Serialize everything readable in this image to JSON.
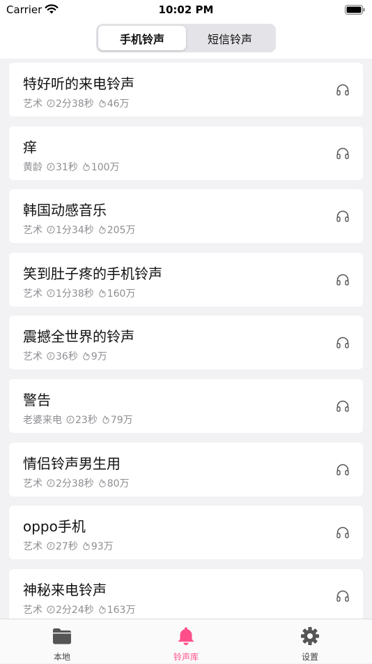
{
  "status_bar": {
    "carrier": "Carrier",
    "time": "10:02 PM"
  },
  "segments": [
    "手机铃声",
    "短信铃声"
  ],
  "selected_segment": 0,
  "ringtones": [
    {
      "title": "特好听的来电铃声",
      "artist": "艺术",
      "duration": "2分38秒",
      "plays": "46万"
    },
    {
      "title": "痒",
      "artist": "黄龄",
      "duration": "31秒",
      "plays": "100万"
    },
    {
      "title": "韩国动感音乐",
      "artist": "艺术",
      "duration": "1分34秒",
      "plays": "205万"
    },
    {
      "title": "笑到肚子疼的手机铃声",
      "artist": "艺术",
      "duration": "1分38秒",
      "plays": "160万"
    },
    {
      "title": "震撼全世界的铃声",
      "artist": "艺术",
      "duration": "36秒",
      "plays": "9万"
    },
    {
      "title": "警告",
      "artist": "老婆来电",
      "duration": "23秒",
      "plays": "79万"
    },
    {
      "title": "情侣铃声男生用",
      "artist": "艺术",
      "duration": "2分38秒",
      "plays": "80万"
    },
    {
      "title": "oppo手机",
      "artist": "艺术",
      "duration": "27秒",
      "plays": "93万"
    },
    {
      "title": "神秘来电铃声",
      "artist": "艺术",
      "duration": "2分24秒",
      "plays": "163万"
    }
  ],
  "tabs": [
    {
      "label": "本地",
      "icon": "folder-icon"
    },
    {
      "label": "铃声库",
      "icon": "bell-icon"
    },
    {
      "label": "设置",
      "icon": "gear-icon"
    }
  ],
  "selected_tab": 1,
  "colors": {
    "accent": "#ff4f8a",
    "meta_text": "#8e8e93",
    "background": "#f2f2f4"
  }
}
